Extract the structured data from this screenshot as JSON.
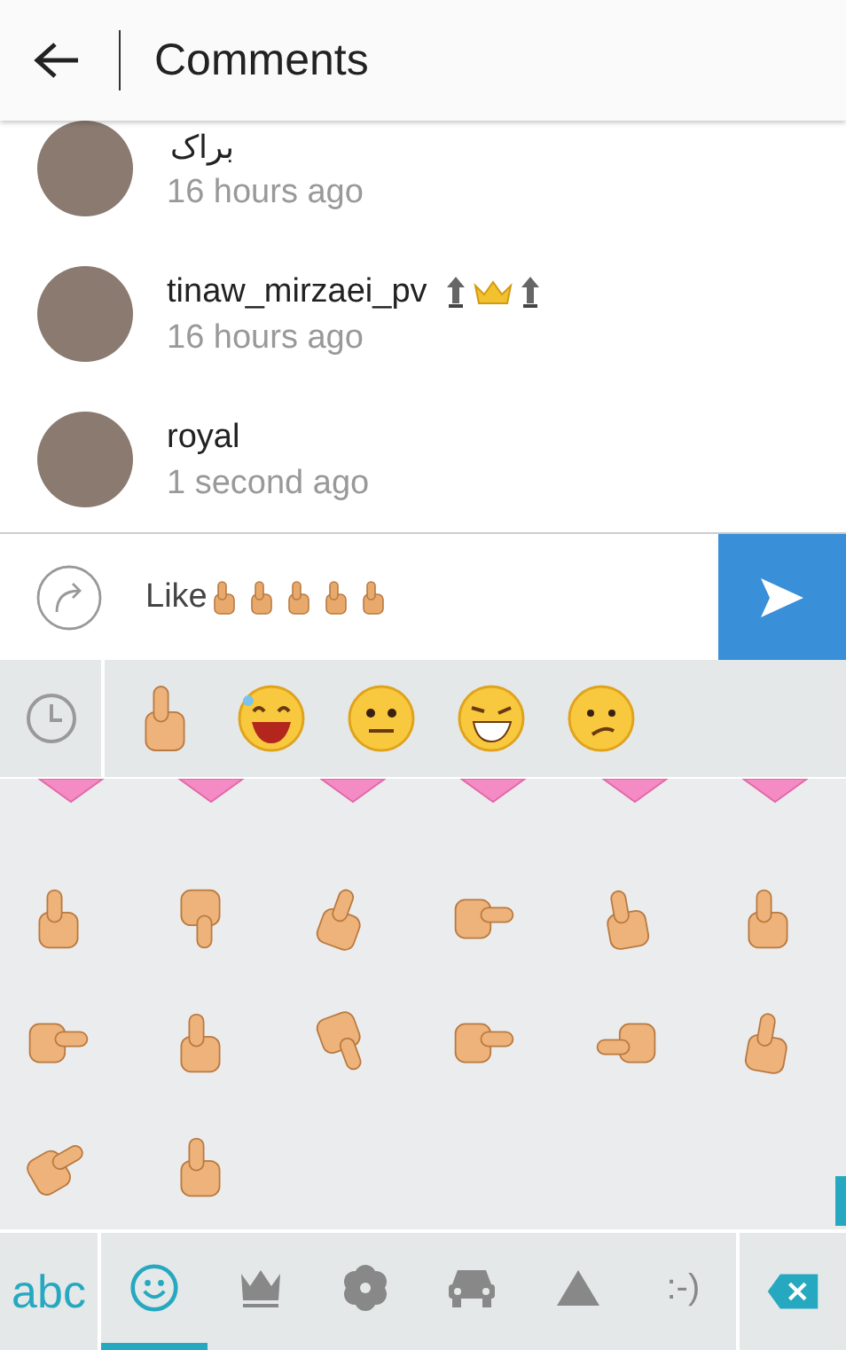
{
  "header": {
    "title": "Comments"
  },
  "comments": [
    {
      "text": "براک",
      "time": "16 hours ago"
    },
    {
      "username": "tinaw_mirzaei_pv",
      "badges": true,
      "time": "16 hours ago"
    },
    {
      "username": "royal",
      "badges": false,
      "time": "1 second ago"
    }
  ],
  "composer": {
    "value": "Like"
  },
  "keyboard": {
    "abc_key": "abc",
    "tabs": [
      {
        "kind": "smiley",
        "selected": true
      },
      {
        "kind": "crown",
        "selected": false
      },
      {
        "kind": "flower",
        "selected": false
      },
      {
        "kind": "car",
        "selected": false
      },
      {
        "kind": "triangle",
        "selected": false
      },
      {
        "kind": "text",
        "label": ":-)",
        "selected": false
      }
    ]
  }
}
